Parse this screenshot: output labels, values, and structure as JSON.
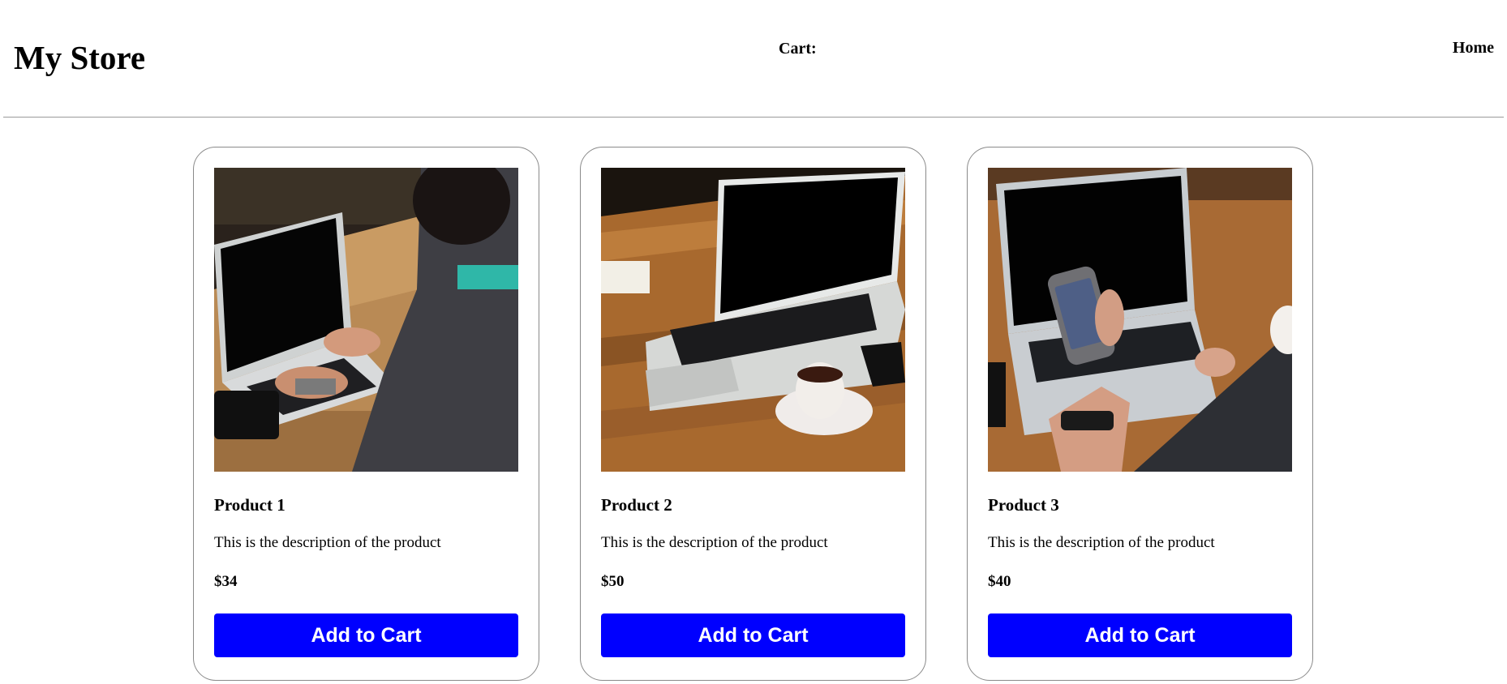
{
  "header": {
    "title": "My Store",
    "cart_label": "Cart:",
    "home_link": "Home"
  },
  "products": [
    {
      "name": "Product 1",
      "description": "This is the description of the product",
      "price": "$34",
      "button_label": "Add to Cart",
      "image_alt": "person typing on laptop at wooden table"
    },
    {
      "name": "Product 2",
      "description": "This is the description of the product",
      "price": "$50",
      "button_label": "Add to Cart",
      "image_alt": "open laptop with coffee cup on wooden table"
    },
    {
      "name": "Product 3",
      "description": "This is the description of the product",
      "price": "$40",
      "button_label": "Add to Cart",
      "image_alt": "hand holding phone in front of laptop"
    }
  ],
  "colors": {
    "button": "#0000ff",
    "button_text": "#ffffff",
    "border": "#8a8a8a"
  }
}
